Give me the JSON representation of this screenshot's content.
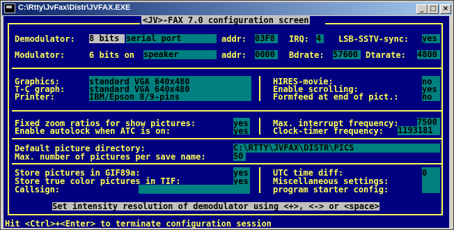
{
  "window": {
    "title": "C:\\Rtty\\JvFax\\Distr\\JVFAX.EXE",
    "minimize": "_",
    "maximize": "□",
    "close": "×"
  },
  "header": "<JV>-FAX 7.0 configuration screen",
  "demod": {
    "label": "Demodulator:",
    "bits": "8 bits",
    "port": "serial port",
    "addr_label": "addr:",
    "addr": "03F8",
    "irq_label": "IRQ:",
    "irq": "4",
    "lsb_label": "LSB-SSTV-sync:",
    "lsb": "yes"
  },
  "mod": {
    "label": "Modulator:",
    "bits": "6 bits on",
    "output": "speaker",
    "addr_label": "addr:",
    "addr": "0000",
    "bdrate_label": "Bdrate:",
    "bdrate": "57600",
    "dtarate_label": "Dtarate:",
    "dtarate": "4800"
  },
  "graphics": {
    "graphics_label": "Graphics:",
    "graphics": "standard VGA 640x480",
    "tc_label": "T-C graph:",
    "tc": "standard VGA 640x480",
    "printer_label": "Printer:",
    "printer": "IBM/Epson 8/9-pins",
    "hires_label": "HIRES-movie:",
    "hires": "no",
    "scroll_label": "Enable scrolling:",
    "scroll": "yes",
    "formfeed_label": "Formfeed at end of pict.:",
    "formfeed": "no"
  },
  "zoom": {
    "fixed_label": "Fixed zoom ratios for show pictures:",
    "fixed": "yes",
    "autolock_label": "Enable autolock when ATC is on:",
    "autolock": "yes",
    "maxint_label": "Max. interrupt frequency:",
    "maxint": "7500",
    "clock_label": "Clock-timer frequency:",
    "clock": "1193181"
  },
  "pics": {
    "dir_label": "Default picture directory:",
    "dir": "C:\\RTTY\\JVFAX\\DISTR\\PICS",
    "max_label": "Max. number of pictures per save name:",
    "max": "50"
  },
  "store": {
    "gif_label": "Store pictures in GIF89a:",
    "gif": "yes",
    "tif_label": "Store true color pictures in TIF:",
    "tif": "yes",
    "call_label": "Callsign:",
    "call": "",
    "utc_label": "UTC time diff:",
    "utc": "0",
    "misc_label": "Miscellaneous settings:",
    "prog_label": "program starter config:"
  },
  "status": "Set intensity resolution of demodulator using <+>, <-> or <space>",
  "footer": "Hit <Ctrl>+<Enter> to terminate configuration session"
}
